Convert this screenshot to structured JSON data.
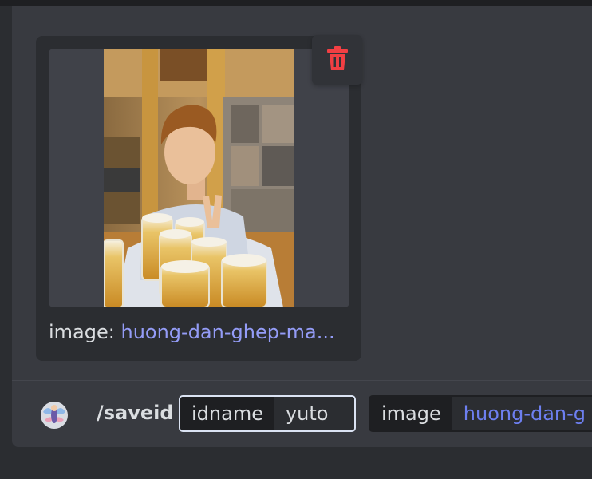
{
  "attachment": {
    "caption_label": "image:",
    "caption_filename": "huong-dan-ghep-ma...",
    "delete_icon": "trash-icon",
    "photo": "photo of a young man making a peace sign behind several glasses of beer"
  },
  "composer": {
    "avatar_icon": "bot-avatar-icon",
    "command": "/saveid",
    "options": [
      {
        "name": "idname",
        "value": "yuto"
      },
      {
        "name": "image",
        "value": "huong-dan-g"
      }
    ]
  },
  "colors": {
    "danger": "#f23f43",
    "link": "#949cf7",
    "background": "#2b2d31"
  }
}
